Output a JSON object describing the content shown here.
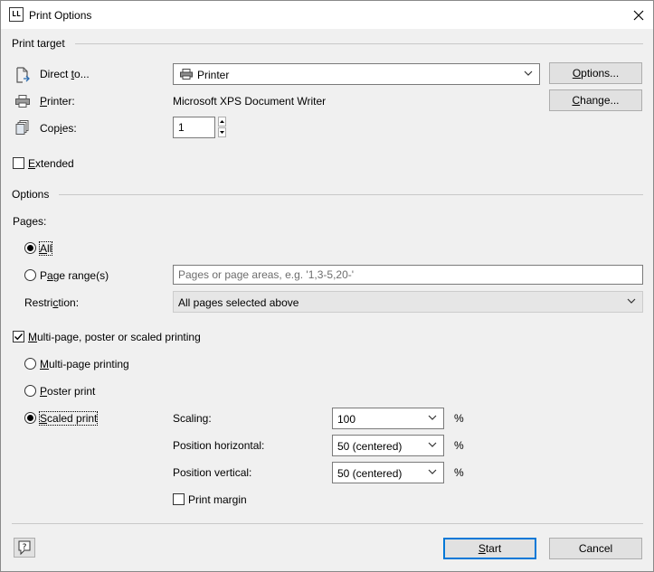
{
  "window": {
    "title": "Print Options",
    "app_icon_text": "LL"
  },
  "print_target": {
    "group_label": "Print target",
    "direct_to": {
      "label_pre": "Direct ",
      "label_key": "t",
      "label_post": "o...",
      "value": "Printer"
    },
    "printer": {
      "label_key": "P",
      "label_post": "rinter:",
      "value": "Microsoft XPS Document Writer"
    },
    "copies": {
      "label_pre": "Cop",
      "label_key": "i",
      "label_post": "es:",
      "value": "1"
    },
    "options_button": {
      "key": "O",
      "rest": "ptions..."
    },
    "change_button": {
      "key": "C",
      "rest": "hange..."
    },
    "extended": {
      "key": "E",
      "rest": "xtended",
      "checked": false
    }
  },
  "options": {
    "group_label": "Options",
    "pages_label": "Pages:",
    "all": {
      "key": "A",
      "rest": "ll",
      "selected": true
    },
    "page_range": {
      "pre": "P",
      "key": "a",
      "rest": "ge range(s)",
      "placeholder": "Pages or page areas, e.g. '1,3-5,20-'",
      "selected": false
    },
    "restriction": {
      "pre": "Restri",
      "key": "c",
      "rest": "tion:",
      "value": "All pages selected above"
    },
    "multipage_group": {
      "key": "M",
      "rest": "ulti-page, poster or scaled printing",
      "checked": true
    },
    "multipage_printing": {
      "key": "M",
      "rest": "ulti-page printing",
      "selected": false
    },
    "poster_print": {
      "key": "P",
      "rest": "oster print",
      "selected": false
    },
    "scaled_print": {
      "key": "S",
      "rest": "caled print",
      "selected": true
    },
    "scaling": {
      "label": "Scaling:",
      "value": "100",
      "unit": "%"
    },
    "position_horizontal": {
      "label": "Position horizontal:",
      "value": "50 (centered)",
      "unit": "%"
    },
    "position_vertical": {
      "label": "Position vertical:",
      "value": "50 (centered)",
      "unit": "%"
    },
    "print_margin": {
      "label": "Print margin",
      "checked": false
    }
  },
  "footer": {
    "start_button": {
      "key": "S",
      "rest": "tart"
    },
    "cancel_button": "Cancel"
  }
}
